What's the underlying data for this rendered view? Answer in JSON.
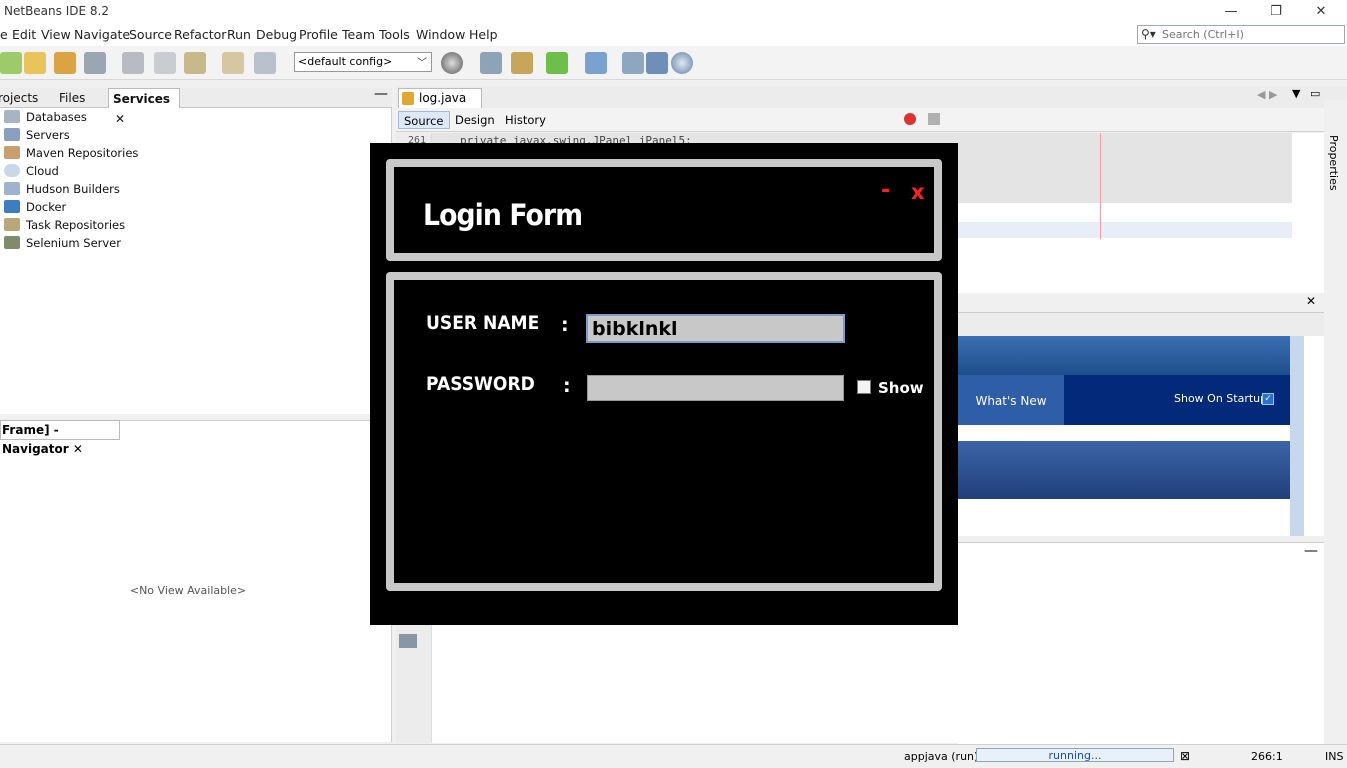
{
  "window": {
    "title": "NetBeans IDE 8.2",
    "minimize": "—",
    "maximize": "❐",
    "close": "✕"
  },
  "menu": [
    "e",
    "Edit",
    "View",
    "Navigate",
    "Source",
    "Refactor",
    "Run",
    "Debug",
    "Profile",
    "Team",
    "Tools",
    "Window",
    "Help"
  ],
  "search": {
    "placeholder": "Search (Ctrl+I)"
  },
  "toolbar": {
    "config_value": "<default config>"
  },
  "left_panel": {
    "tabs": [
      "rojects",
      "Files",
      "Services"
    ],
    "active_tab_close": "✕",
    "services": [
      "Databases",
      "Servers",
      "Maven Repositories",
      "Cloud",
      "Hudson Builders",
      "Docker",
      "Task Repositories",
      "Selenium Server"
    ]
  },
  "navigator": {
    "tab_label": "Frame] - Navigator",
    "tab_close": "✕",
    "empty_text": "<No View Available>"
  },
  "editor": {
    "file_tab": "log.java",
    "file_tab_close": "✕",
    "view_tabs": [
      "Source",
      "Design",
      "History"
    ],
    "line_number": "261",
    "code_snippet": "    private javax.swing.JPanel jPanel5;"
  },
  "start_page": {
    "whats_new": "What's New",
    "show_on_startup": "Show On Startup"
  },
  "status": {
    "task": "appjava (run)",
    "progress_text": "running...",
    "caret": "266:1",
    "mode": "INS"
  },
  "login": {
    "title": "Login Form",
    "minimize": "-",
    "close": "x",
    "username_label": "USER NAME",
    "password_label": "PASSWORD",
    "colon": ":",
    "username_value": "bibklnkl",
    "password_value": "",
    "show_label": "Show"
  },
  "colors": {
    "dialog_bg": "#000000",
    "dialog_border": "#c8c8c8",
    "accent_red": "#ff2020",
    "field_bg": "#c8c8c8"
  }
}
